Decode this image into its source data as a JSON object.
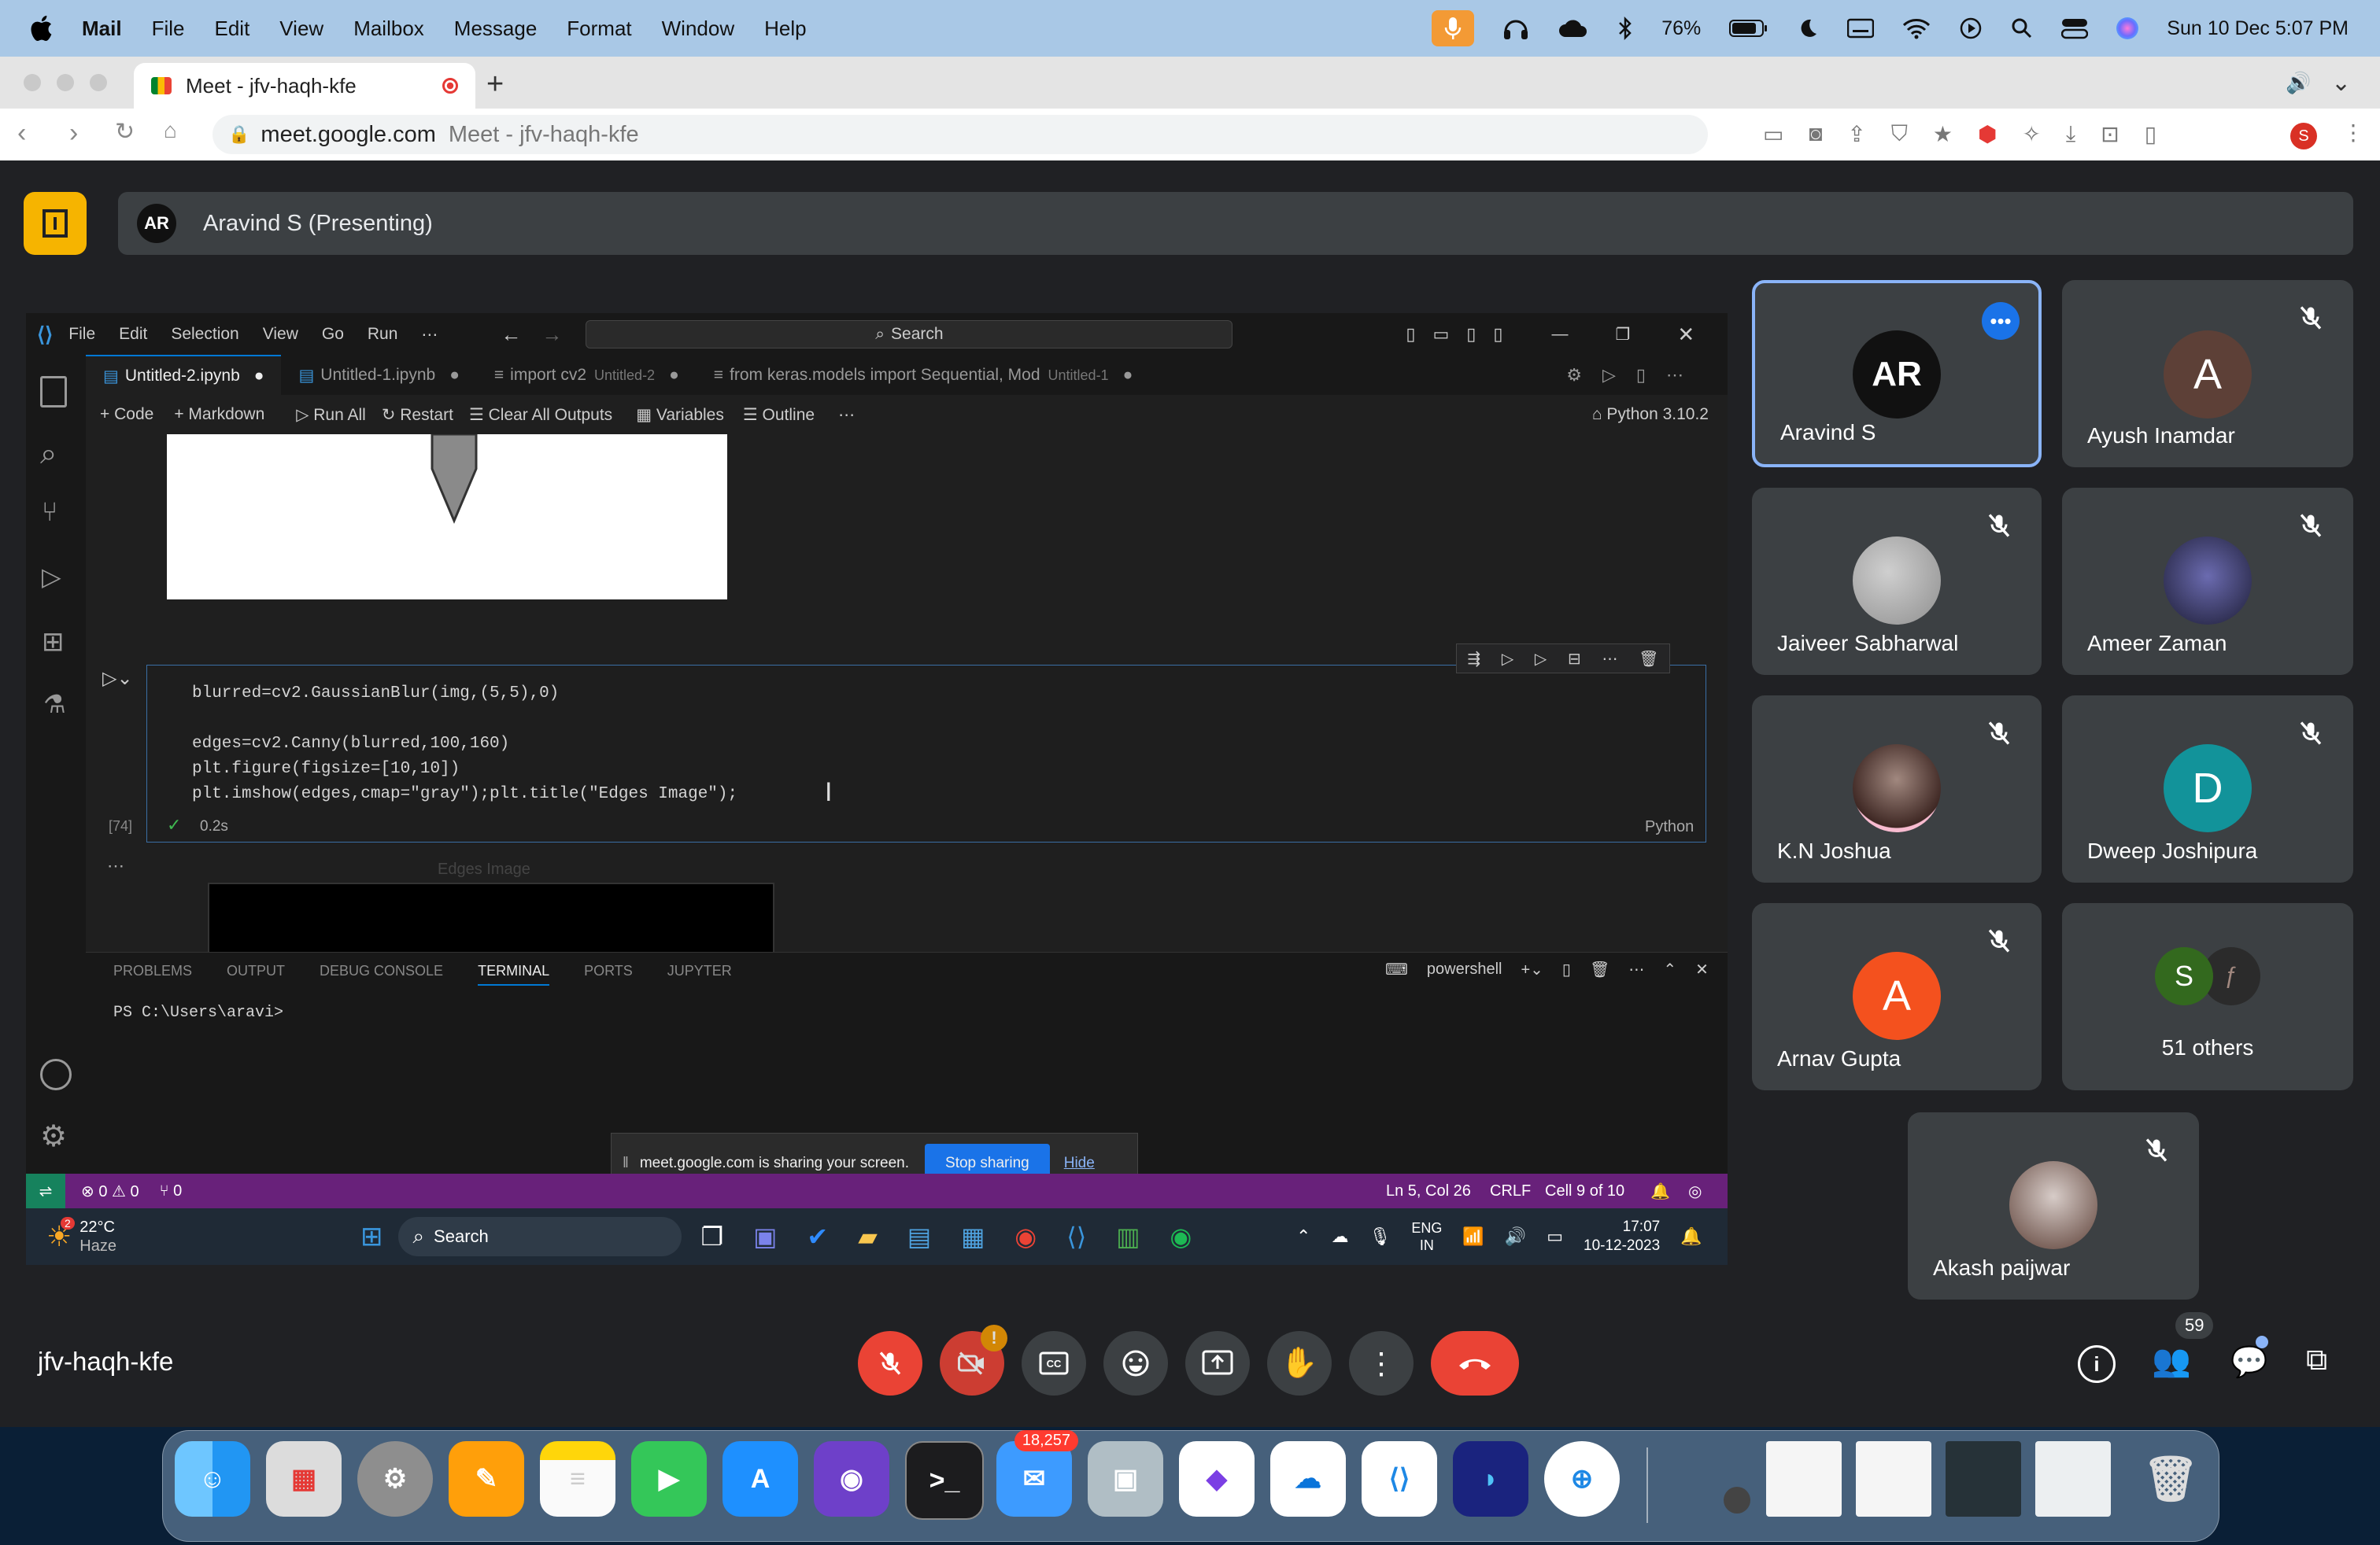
{
  "menubar": {
    "app": "Mail",
    "items": [
      "File",
      "Edit",
      "View",
      "Mailbox",
      "Message",
      "Format",
      "Window",
      "Help"
    ],
    "battery": "76%",
    "datetime": "Sun 10 Dec  5:07 PM"
  },
  "browser": {
    "tab_title": "Meet - jfv-haqh-kfe",
    "url_host": "meet.google.com",
    "url_title": "Meet - jfv-haqh-kfe",
    "profile_initial": "S"
  },
  "meet": {
    "presenter_label": "Aravind S (Presenting)",
    "presenter_avatar": "AR",
    "meeting_code": "jfv-haqh-kfe",
    "people_count": "59",
    "participants": [
      {
        "name": "Aravind S",
        "initial": "AR",
        "color": "#111111"
      },
      {
        "name": "Ayush Inamdar",
        "initial": "A",
        "color": "#5d4037"
      },
      {
        "name": "Jaiveer Sabharwal",
        "initial": "",
        "color": "#9e9e9e"
      },
      {
        "name": "Ameer Zaman",
        "initial": "",
        "color": "#2a2a4a"
      },
      {
        "name": "K.N Joshua",
        "initial": "",
        "color": "#6d4c41"
      },
      {
        "name": "Dweep Joshipura",
        "initial": "D",
        "color": "#12939a"
      },
      {
        "name": "Arnav Gupta",
        "initial": "A",
        "color": "#f4511e"
      },
      {
        "name": "51 others",
        "initial": "S",
        "color": "#33691e"
      },
      {
        "name": "Akash paijwar",
        "initial": "",
        "color": "#8d6e63"
      }
    ],
    "camera_alert": "!"
  },
  "vscode": {
    "menu": [
      "File",
      "Edit",
      "Selection",
      "View",
      "Go",
      "Run",
      "⋯"
    ],
    "search_placeholder": "Search",
    "tabs": [
      {
        "label": "Untitled-2.ipynb",
        "hint": ""
      },
      {
        "label": "Untitled-1.ipynb",
        "hint": ""
      },
      {
        "label": "import cv2",
        "hint": "Untitled-2"
      },
      {
        "label": "from keras.models import Sequential, Mod",
        "hint": "Untitled-1"
      }
    ],
    "toolbar": [
      "+ Code",
      "+ Markdown",
      "Run All",
      "Restart",
      "Clear All Outputs",
      "Variables",
      "Outline",
      "⋯"
    ],
    "kernel": "Python 3.10.2",
    "code_lines": [
      "blurred=cv2.GaussianBlur(img,(5,5),0)",
      "",
      "edges=cv2.Canny(blurred,100,160)",
      "plt.figure(figsize=[10,10])",
      "plt.imshow(edges,cmap=\"gray\");plt.title(\"Edges Image\");"
    ],
    "exec_count": "[74]",
    "exec_time": "0.2s",
    "cell_lang": "Python",
    "output_title": "Edges Image",
    "panel_tabs": [
      "PROBLEMS",
      "OUTPUT",
      "DEBUG CONSOLE",
      "TERMINAL",
      "PORTS",
      "JUPYTER"
    ],
    "terminal_shell": "powershell",
    "terminal_prompt": "PS C:\\Users\\aravi>",
    "status_left": [
      "⊗ 0 ⚠ 0",
      "⑂ 0"
    ],
    "status_right": [
      "Ln 5, Col 26",
      "CRLF",
      "Cell 9 of 10"
    ],
    "share_notice": "meet.google.com is sharing your screen.",
    "stop_sharing": "Stop sharing",
    "hide": "Hide"
  },
  "windows_taskbar": {
    "weather_temp": "22°C",
    "weather_desc": "Haze",
    "search": "Search",
    "lang": "ENG",
    "region": "IN",
    "time": "17:07",
    "date": "10-12-2023",
    "notif": "2"
  },
  "dock": {
    "mail_badge": "18,257"
  }
}
